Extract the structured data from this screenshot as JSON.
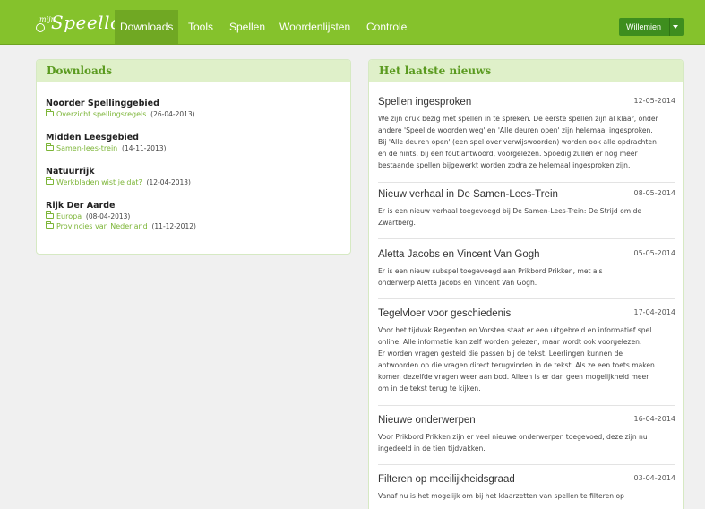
{
  "nav": {
    "logo_small": "mijn",
    "logo_word": "Speellokaal",
    "items": [
      {
        "label": "Downloads",
        "active": true
      },
      {
        "label": "Tools"
      },
      {
        "label": "Spellen"
      },
      {
        "label": "Woordenlijsten"
      },
      {
        "label": "Controle"
      }
    ],
    "user": "Willemien"
  },
  "downloads": {
    "heading": "Downloads",
    "groups": [
      {
        "title": "Noorder Spellinggebied",
        "files": [
          {
            "name": "Overzicht spellingsregels",
            "date": "(26-04-2013)"
          }
        ]
      },
      {
        "title": "Midden Leesgebied",
        "files": [
          {
            "name": "Samen-lees-trein",
            "date": "(14-11-2013)"
          }
        ]
      },
      {
        "title": "Natuurrijk",
        "files": [
          {
            "name": "Werkbladen wist je dat?",
            "date": "(12-04-2013)"
          }
        ]
      },
      {
        "title": "Rijk Der Aarde",
        "files": [
          {
            "name": "Europa",
            "date": "(08-04-2013)"
          },
          {
            "name": "Provincies van Nederland",
            "date": "(11-12-2012)"
          }
        ]
      }
    ]
  },
  "news": {
    "heading": "Het laatste nieuws",
    "items": [
      {
        "title": "Spellen ingesproken",
        "date": "12-05-2014",
        "lines": [
          "We zijn druk bezig met spellen in te spreken. De eerste spellen zijn al klaar, onder",
          "andere 'Speel de woorden weg' en 'Alle deuren open' zijn helemaal ingesproken.",
          "Bij 'Alle deuren open' (een spel over verwijswoorden) worden ook alle opdrachten",
          "en de hints, bij een fout antwoord, voorgelezen. Spoedig zullen er nog meer",
          "bestaande spellen bijgewerkt worden zodra ze helemaal ingesproken zijn."
        ]
      },
      {
        "title": "Nieuw verhaal in De Samen-Lees-Trein",
        "date": "08-05-2014",
        "lines": [
          "Er is een nieuw verhaal toegevoegd bij De Samen-Lees-Trein: De Strijd om de",
          "Zwartberg."
        ]
      },
      {
        "title": "Aletta Jacobs en Vincent Van Gogh",
        "date": "05-05-2014",
        "lines": [
          "Er is een nieuw subspel toegevoegd aan Prikbord Prikken, met als",
          "onderwerp Aletta Jacobs en Vincent Van Gogh."
        ]
      },
      {
        "title": "Tegelvloer voor geschiedenis",
        "date": "17-04-2014",
        "lines": [
          "Voor het tijdvak Regenten en Vorsten staat er een uitgebreid en informatief spel",
          "online. Alle informatie kan zelf worden gelezen, maar wordt ook voorgelezen.",
          "Er worden vragen gesteld die passen bij de tekst. Leerlingen kunnen de",
          "antwoorden op die vragen direct terugvinden in de tekst. Als ze een toets maken",
          "komen dezelfde vragen weer aan bod. Alleen is er dan geen mogelijkheid meer",
          "om in de tekst terug te kijken."
        ]
      },
      {
        "title": "Nieuwe onderwerpen",
        "date": "16-04-2014",
        "lines": [
          "Voor Prikbord Prikken zijn er veel nieuwe onderwerpen toegevoed, deze zijn nu",
          "ingedeeld in de tien tijdvakken."
        ]
      },
      {
        "title": "Filteren op moeilijkheidsgraad",
        "date": "03-04-2014",
        "lines": [
          "Vanaf nu is het mogelijk om bij het klaarzetten van spellen te filteren op"
        ]
      }
    ]
  }
}
